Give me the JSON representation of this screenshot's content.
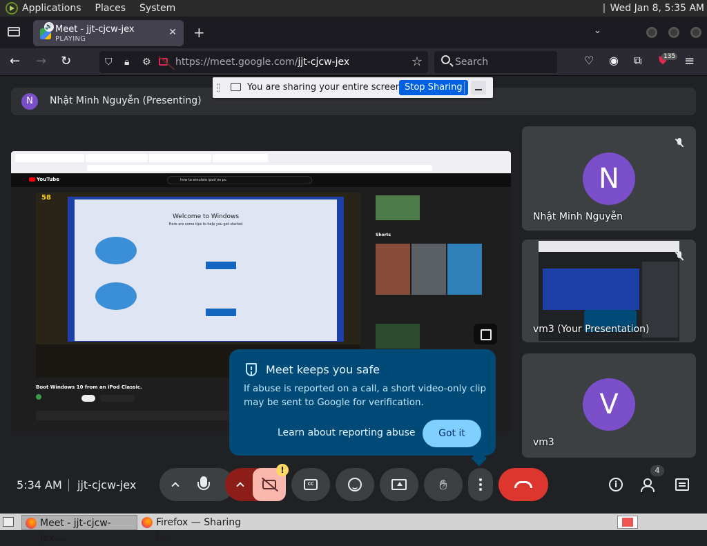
{
  "panel": {
    "menus": [
      "Applications",
      "Places",
      "System"
    ],
    "clock": "Wed Jan  8,  5:35 AM"
  },
  "browser": {
    "tab": {
      "title": "Meet - jjt-cjcw-jex",
      "subtitle": "PLAYING"
    },
    "url_host": "https://meet.google.com/",
    "url_path": "jjt-cjcw-jex",
    "search_placeholder": "Search",
    "extension_badge": "135"
  },
  "share_notification": {
    "message": "You are sharing your entire screen.",
    "stop_label": "Stop Sharing"
  },
  "meet": {
    "presenter_initial": "N",
    "presenter_label": "Nhật Minh Nguyễn (Presenting)",
    "shared_screen": {
      "counter": "58",
      "search_text": "how to emulate ipod on pc",
      "welcome_title": "Welcome to Windows",
      "welcome_sub": "Here are some tips to help you get started",
      "video_title": "Boot Windows 10 from an iPod Classic.",
      "shorts_label": "Shorts"
    },
    "participants": [
      {
        "initial": "N",
        "name": "Nhật Minh Nguyễn",
        "color": "#7b4fc9"
      },
      {
        "name": "vm3 (Your Presentation)"
      },
      {
        "initial": "V",
        "name": "vm3",
        "color": "#7b4fc9"
      }
    ],
    "safety_popup": {
      "title": "Meet keeps you safe",
      "body": "If abuse is reported on a call, a short video-only clip may be sent to Google for verification.",
      "learn_link": "Learn about reporting abuse",
      "got_it": "Got it"
    },
    "bottom": {
      "time": "5:34 AM",
      "meeting_code": "jjt-cjcw-jex",
      "camera_warning": "!",
      "people_count": "4"
    }
  },
  "taskbar": {
    "items": [
      "Meet - jjt-cjcw-jex....",
      "Firefox — Sharing I..."
    ]
  },
  "colors": {
    "meet_bg": "#202124",
    "tile_bg": "#3c4043",
    "avatar_purple": "#7b4fc9",
    "popup_bg": "#004a77",
    "hangup_red": "#dc362e",
    "stop_sharing_blue": "#0061e0"
  }
}
